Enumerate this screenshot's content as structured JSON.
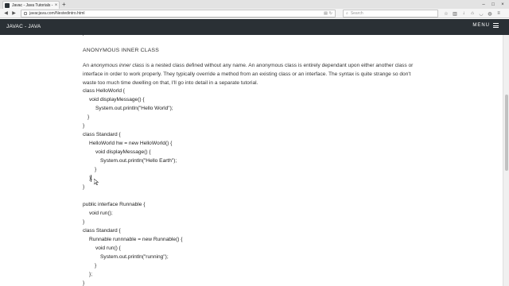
{
  "browser": {
    "tab_title": "Javac - Java Tutorials - Intr...",
    "tab_close": "×",
    "new_tab": "+",
    "window_controls": {
      "minimize": "–",
      "maximize": "□",
      "close": "×"
    },
    "url": "javacjava.com/Nestedintro.html",
    "search_placeholder": "Search",
    "icons": [
      "back-icon",
      "forward-icon",
      "reload-icon",
      "lock-icon",
      "reader-icon",
      "bookmark-star-icon",
      "library-icon",
      "download-icon",
      "home-icon",
      "pocket-icon",
      "shield-icon",
      "menu-icon"
    ]
  },
  "site": {
    "title": "JAVAC - JAVA",
    "menu_label": "MENU"
  },
  "article": {
    "stray_mark": "/",
    "heading": "ANONYMOUS INNER CLASS",
    "para_lead": "An ",
    "para_em": "anonymous inner class",
    "para_rest": " is a nested class defined without any name. An anonymous class is entirely dependant upon either another class or interface in order to work properly. They typically override a method from an existing class or an interface. The syntax is quite strange so don't waste too much time dwelling on that, I'll go into detail in a separate tutorial.",
    "code_lines": [
      "class HelloWorld {",
      "void displayMessage() {",
      "System.out.println(\"Hello World\");",
      "}",
      "}",
      "class Standard {",
      "HelloWorld hw = new HelloWorld() {",
      "void displayMessage() {",
      "System.out.println(\"Hello Earth\");",
      "}",
      "};",
      "}",
      "public interface Runnable {",
      "void run();",
      "}",
      "class Standard {",
      "Runnable runnnable = new Runnable() {",
      "void run() {",
      "System.out.println(\"running\");",
      "}",
      "};",
      "}"
    ]
  }
}
